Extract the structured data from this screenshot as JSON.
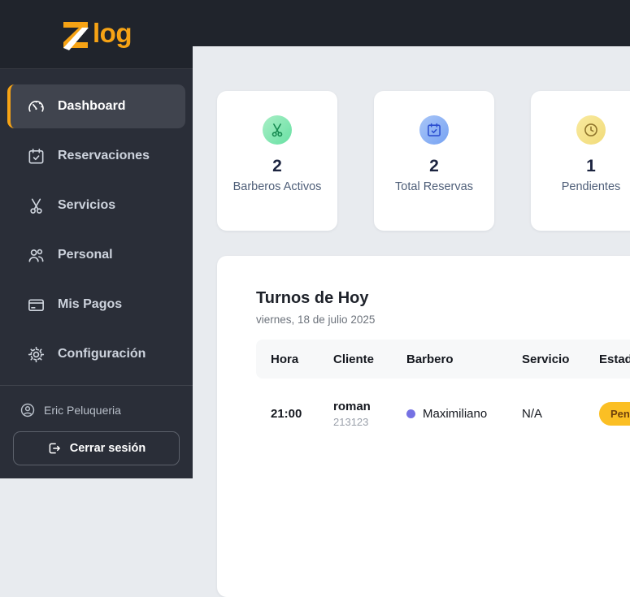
{
  "brand": {
    "logo_z": "Z",
    "logo_suffix": "log"
  },
  "sidebar": {
    "items": [
      {
        "label": "Dashboard",
        "icon": "gauge-icon",
        "active": true
      },
      {
        "label": "Reservaciones",
        "icon": "calendar-check-icon",
        "active": false
      },
      {
        "label": "Servicios",
        "icon": "scissors-icon",
        "active": false
      },
      {
        "label": "Personal",
        "icon": "people-icon",
        "active": false
      },
      {
        "label": "Mis Pagos",
        "icon": "credit-card-icon",
        "active": false
      },
      {
        "label": "Configuración",
        "icon": "gear-icon",
        "active": false
      }
    ],
    "user": {
      "name": "Eric Peluqueria"
    },
    "logout_label": "Cerrar sesión"
  },
  "stats": {
    "cards": [
      {
        "value": "2",
        "label": "Barberos Activos",
        "icon": "scissors-icon",
        "accent": "#67E0A3"
      },
      {
        "value": "2",
        "label": "Total Reservas",
        "icon": "calendar-check-icon",
        "accent": "#76A2F2"
      },
      {
        "value": "1",
        "label": "Pendientes",
        "icon": "clock-icon",
        "accent": "#F1DB79"
      }
    ]
  },
  "schedule": {
    "title": "Turnos de Hoy",
    "date": "viernes, 18 de julio 2025",
    "columns": [
      "Hora",
      "Cliente",
      "Barbero",
      "Servicio",
      "Estado"
    ],
    "rows": [
      {
        "hora": "21:00",
        "cliente": "roman",
        "cliente_id": "213123",
        "barbero": "Maximiliano",
        "servicio": "N/A",
        "estado": "Pendiente"
      }
    ]
  },
  "colors": {
    "accent_orange": "#F6A315",
    "sidebar_bg": "#2A2E38",
    "header_bg": "#20242C",
    "page_bg": "#E8EBEF",
    "active_item_bg": "#40444E",
    "stat_green": "#67E0A3",
    "stat_blue": "#76A2F2",
    "stat_yellow": "#F1DB79",
    "stat_value_text": "#1C2440",
    "badge_bg": "#FBBF24",
    "badge_text": "#6F410C",
    "barber_dot": "#7571E3"
  }
}
